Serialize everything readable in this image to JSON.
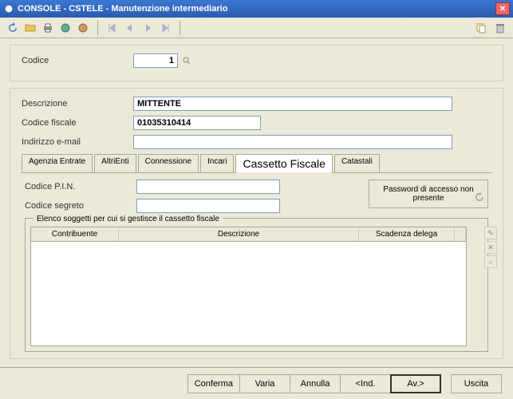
{
  "window": {
    "title": "CONSOLE  - CSTELE -  Manutenzione intermediario"
  },
  "fields": {
    "codice_label": "Codice",
    "codice_value": "1",
    "descrizione_label": "Descrizione",
    "descrizione_value": "MITTENTE",
    "codice_fiscale_label": "Codice fiscale",
    "codice_fiscale_value": "01035310414",
    "indirizzo_email_label": "Indirizzo e-mail",
    "indirizzo_email_value": ""
  },
  "tabs": {
    "items": [
      {
        "label": "Agenzia Entrate"
      },
      {
        "label": "AltriEnti"
      },
      {
        "label": "Connessione"
      },
      {
        "label": "Incari"
      },
      {
        "label": "Cassetto Fiscale"
      },
      {
        "label": "Catastali"
      }
    ]
  },
  "cassetto": {
    "pin_label": "Codice P.I.N.",
    "pin_value": "",
    "segreto_label": "Codice segreto",
    "segreto_value": "",
    "pwd_box": "Password di accesso non presente",
    "elenco_title": "Elenco soggetti per cui si gestisce il cassetto fiscale",
    "col1": "Contribuente",
    "col2": "Descrizione",
    "col3": "Scadenza delega"
  },
  "footer": {
    "conferma": "Conferma",
    "varia": "Varia",
    "annulla": "Annulla",
    "ind": "<Ind.",
    "av": "Av.>",
    "uscita": "Uscita"
  }
}
